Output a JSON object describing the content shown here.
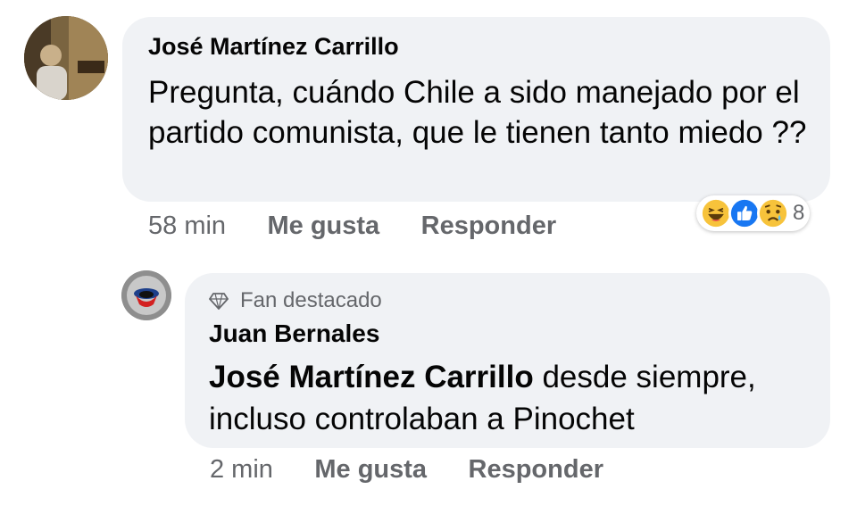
{
  "comment": {
    "author": "José Martínez Carrillo",
    "text": "Pregunta, cuándo Chile a sido manejado por el partido comunista, que le tienen tanto miedo ??",
    "time": "58 min",
    "like_label": "Me gusta",
    "reply_label": "Responder",
    "reactions": {
      "icons": [
        "laugh-reaction-icon",
        "like-reaction-icon",
        "sad-reaction-icon"
      ],
      "count": "8"
    }
  },
  "reply": {
    "badge": "Fan destacado",
    "author": "Juan Bernales",
    "mention": "José Martínez Carrillo",
    "text": " desde siempre, incluso controlaban a Pinochet",
    "time": "2 min",
    "like_label": "Me gusta",
    "reply_label": "Responder"
  },
  "colors": {
    "bubble": "#f0f2f5",
    "meta_text": "#65676b",
    "like_blue": "#1877f2",
    "emoji_yellow": "#f7c33b"
  }
}
